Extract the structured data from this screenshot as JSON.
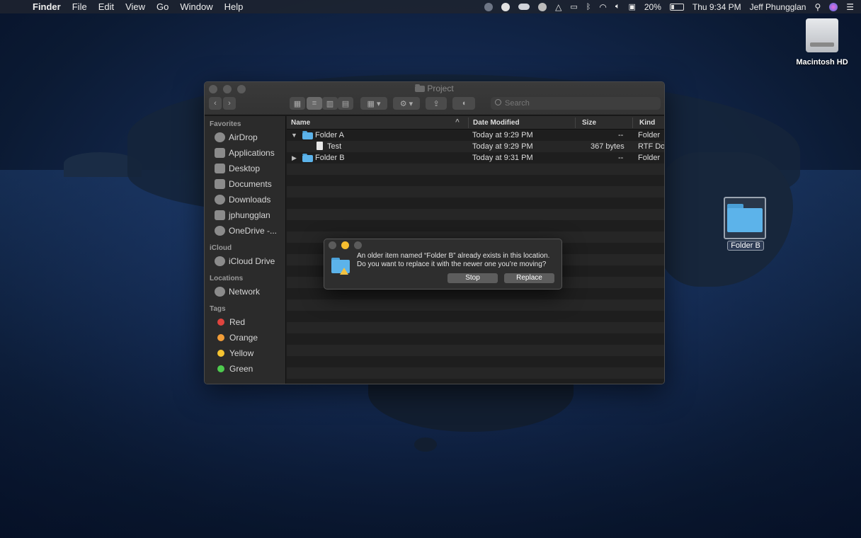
{
  "menubar": {
    "app_name": "Finder",
    "menus": [
      "File",
      "Edit",
      "View",
      "Go",
      "Window",
      "Help"
    ],
    "battery": "20%",
    "clock": "Thu 9:34 PM",
    "user": "Jeff Phungglan"
  },
  "desktop": {
    "drive_label": "Macintosh HD",
    "folder_label": "Folder B"
  },
  "window": {
    "title": "Project",
    "search_placeholder": "Search",
    "sidebar": {
      "favorites_header": "Favorites",
      "favorites": [
        "AirDrop",
        "Applications",
        "Desktop",
        "Documents",
        "Downloads",
        "jphungglan",
        "OneDrive -..."
      ],
      "icloud_header": "iCloud",
      "icloud": [
        "iCloud Drive"
      ],
      "locations_header": "Locations",
      "locations": [
        "Network"
      ],
      "tags_header": "Tags",
      "tags": [
        {
          "name": "Red",
          "color": "#e0443e"
        },
        {
          "name": "Orange",
          "color": "#f29d38"
        },
        {
          "name": "Yellow",
          "color": "#f5c431"
        },
        {
          "name": "Green",
          "color": "#4ecb4e"
        }
      ]
    },
    "columns": {
      "name": "Name",
      "date": "Date Modified",
      "size": "Size",
      "kind": "Kind"
    },
    "rows": [
      {
        "name": "Folder A",
        "date": "Today at 9:29 PM",
        "size": "--",
        "kind": "Folder"
      },
      {
        "name": "Test",
        "date": "Today at 9:29 PM",
        "size": "367 bytes",
        "kind": "RTF Doc"
      },
      {
        "name": "Folder B",
        "date": "Today at 9:31 PM",
        "size": "--",
        "kind": "Folder"
      }
    ]
  },
  "dialog": {
    "line1": "An older item named “Folder B” already exists in this location.",
    "line2": "Do you want to replace it with the newer one you’re moving?",
    "stop_label": "Stop",
    "replace_label": "Replace"
  }
}
